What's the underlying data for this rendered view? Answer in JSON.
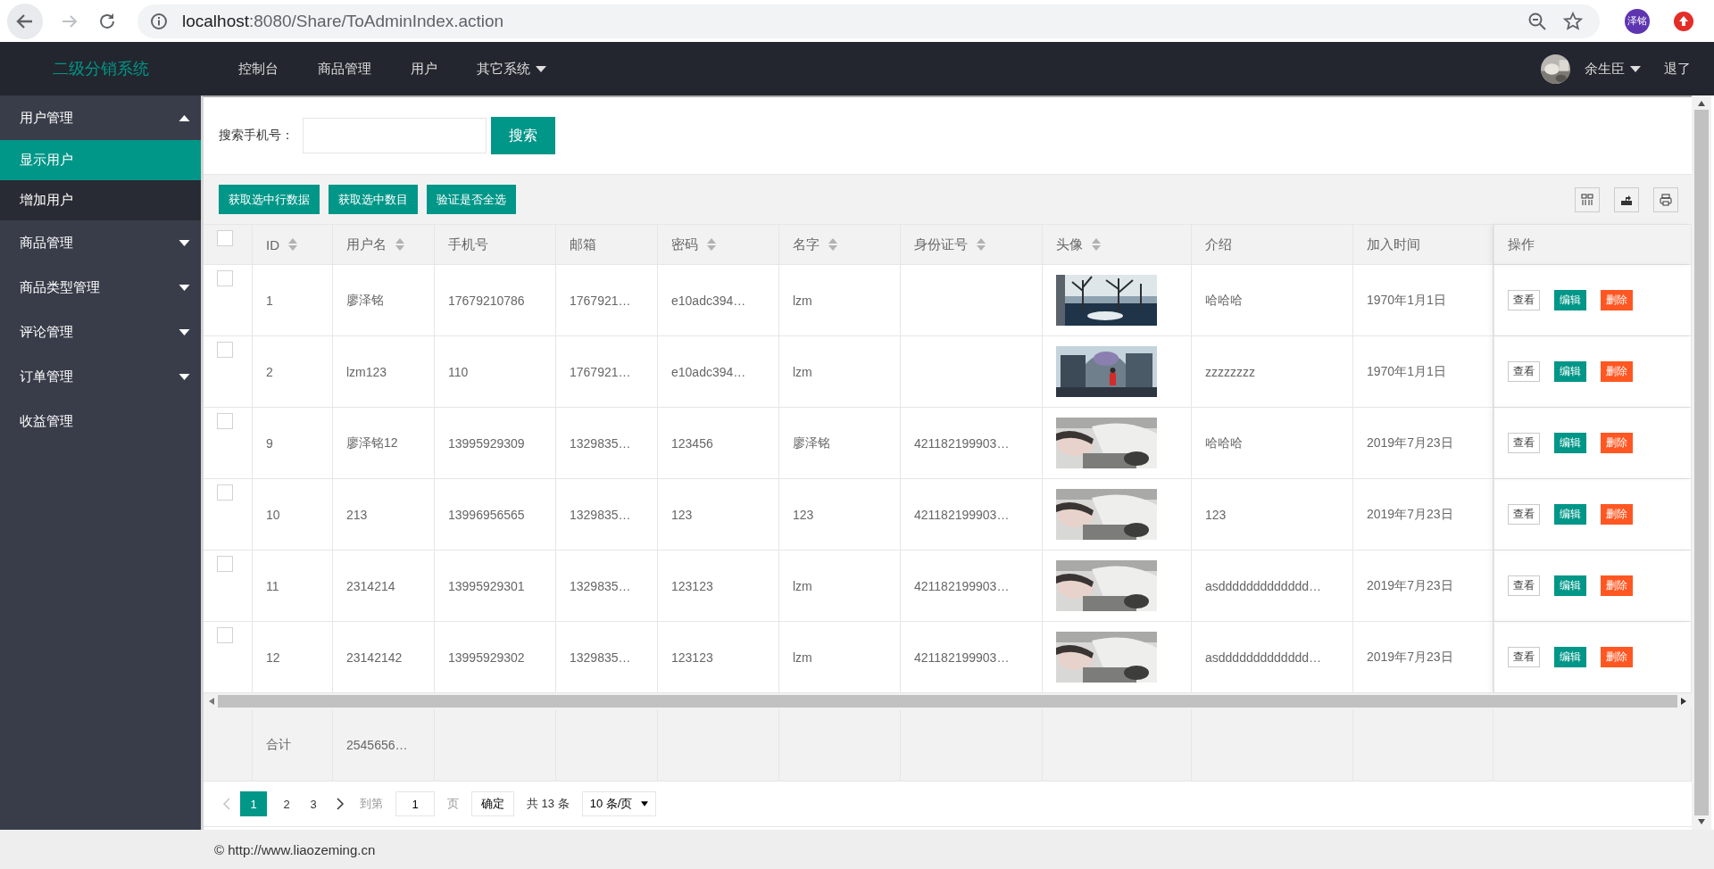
{
  "browser": {
    "url_host": "localhost",
    "url_rest": ":8080/Share/ToAdminIndex.action",
    "profile": "泽铭"
  },
  "nav": {
    "logo": "二级分销系统",
    "items": [
      {
        "label": "控制台",
        "dropdown": false
      },
      {
        "label": "商品管理",
        "dropdown": false
      },
      {
        "label": "用户",
        "dropdown": false
      },
      {
        "label": "其它系统",
        "dropdown": true
      }
    ],
    "user": "余生臣",
    "logout": "退了"
  },
  "sidebar": {
    "items": [
      {
        "label": "用户管理",
        "kind": "group",
        "expanded": true,
        "children": [
          {
            "label": "显示用户",
            "selected": true
          },
          {
            "label": "增加用户",
            "selected": false
          }
        ]
      },
      {
        "label": "商品管理",
        "kind": "group",
        "expanded": false
      },
      {
        "label": "商品类型管理",
        "kind": "group",
        "expanded": false
      },
      {
        "label": "评论管理",
        "kind": "group",
        "expanded": false
      },
      {
        "label": "订单管理",
        "kind": "group",
        "expanded": false
      },
      {
        "label": "收益管理",
        "kind": "link"
      }
    ]
  },
  "search": {
    "label": "搜索手机号：",
    "button": "搜索"
  },
  "toolbar": {
    "buttons": [
      "获取选中行数据",
      "获取选中数目",
      "验证是否全选"
    ]
  },
  "table": {
    "header_checked": false,
    "columns": [
      {
        "label": "ID",
        "sortable": true,
        "kind": "text"
      },
      {
        "label": "用户名",
        "sortable": true,
        "kind": "text"
      },
      {
        "label": "手机号",
        "sortable": false,
        "kind": "text"
      },
      {
        "label": "邮箱",
        "sortable": false,
        "kind": "text"
      },
      {
        "label": "密码",
        "sortable": true,
        "kind": "text"
      },
      {
        "label": "名字",
        "sortable": true,
        "kind": "text"
      },
      {
        "label": "身份证号",
        "sortable": true,
        "kind": "text"
      },
      {
        "label": "头像",
        "sortable": true,
        "kind": "picture"
      },
      {
        "label": "介绍",
        "sortable": false,
        "kind": "text"
      },
      {
        "label": "加入时间",
        "sortable": false,
        "kind": "text"
      },
      {
        "label": "操作",
        "sortable": false,
        "kind": "actions"
      }
    ],
    "rows": [
      {
        "checked": false,
        "cells": [
          "1",
          "廖泽铭",
          "17679210786",
          "1767921…",
          "e10adc394…",
          "lzm",
          null,
          {
            "kind": "picture"
          },
          "哈哈哈",
          "1970年1月1日",
          [
            {
              "label": "查看",
              "kind": "view"
            },
            {
              "label": "编辑",
              "kind": "edit"
            },
            {
              "label": "删除",
              "kind": "delete"
            }
          ]
        ]
      },
      {
        "checked": false,
        "cells": [
          "2",
          "lzm123",
          "110",
          "1767921…",
          "e10adc394…",
          "lzm",
          null,
          {
            "kind": "picture"
          },
          "zzzzzzzz",
          "1970年1月1日",
          [
            {
              "label": "查看",
              "kind": "view"
            },
            {
              "label": "编辑",
              "kind": "edit"
            },
            {
              "label": "删除",
              "kind": "delete"
            }
          ]
        ]
      },
      {
        "checked": false,
        "cells": [
          "9",
          "廖泽铭12",
          "13995929309",
          "1329835…",
          "123456",
          "廖泽铭",
          "421182199903…",
          {
            "kind": "picture"
          },
          "哈哈哈",
          "2019年7月23日",
          [
            {
              "label": "查看",
              "kind": "view"
            },
            {
              "label": "编辑",
              "kind": "edit"
            },
            {
              "label": "删除",
              "kind": "delete"
            }
          ]
        ]
      },
      {
        "checked": false,
        "cells": [
          "10",
          "213",
          "13996956565",
          "1329835…",
          "123",
          "123",
          "421182199903…",
          {
            "kind": "picture"
          },
          "123",
          "2019年7月23日",
          [
            {
              "label": "查看",
              "kind": "view"
            },
            {
              "label": "编辑",
              "kind": "edit"
            },
            {
              "label": "删除",
              "kind": "delete"
            }
          ]
        ]
      },
      {
        "checked": false,
        "cells": [
          "11",
          "2314214",
          "13995929301",
          "1329835…",
          "123123",
          "lzm",
          "421182199903…",
          {
            "kind": "picture"
          },
          "asddddddddddddd…",
          "2019年7月23日",
          [
            {
              "label": "查看",
              "kind": "view"
            },
            {
              "label": "编辑",
              "kind": "edit"
            },
            {
              "label": "删除",
              "kind": "delete"
            }
          ]
        ]
      },
      {
        "checked": false,
        "cells": [
          "12",
          "23142142",
          "13995929302",
          "1329835…",
          "123123",
          "lzm",
          "421182199903…",
          {
            "kind": "picture"
          },
          "asddddddddddddd…",
          "2019年7月23日",
          [
            {
              "label": "查看",
              "kind": "view"
            },
            {
              "label": "编辑",
              "kind": "edit"
            },
            {
              "label": "删除",
              "kind": "delete"
            }
          ]
        ]
      }
    ],
    "totals": [
      "合计",
      "2545656…"
    ]
  },
  "pagination": {
    "prev_disabled": true,
    "pages": [
      {
        "label": "1",
        "selected": true
      },
      {
        "label": "2",
        "selected": false
      },
      {
        "label": "3",
        "selected": false
      }
    ],
    "goto_label": "到第",
    "goto_value": "1",
    "page_unit": "页",
    "confirm": "确定",
    "total": "共 13 条",
    "page_size": "10 条/页"
  },
  "footer": "© http://www.liaozeming.cn"
}
